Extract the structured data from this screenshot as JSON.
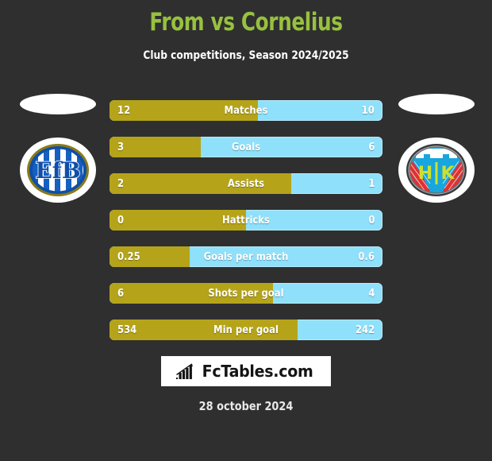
{
  "header": {
    "title": "From vs Cornelius",
    "subtitle": "Club competitions, Season 2024/2025",
    "title_color": "#97c13f",
    "background_color": "#2f2f2f"
  },
  "crests": {
    "home": {
      "name": "EfB",
      "alt": "home-club-crest"
    },
    "away": {
      "name": "HIK",
      "alt": "away-club-crest"
    }
  },
  "colors": {
    "home_bar": "#b5a41a",
    "away_bar": "#8fe0fb",
    "text": "#ffffff"
  },
  "chart_data": {
    "type": "bar",
    "title": "From vs Cornelius",
    "subtitle": "Club competitions, Season 2024/2025",
    "orientation": "horizontal-diverging",
    "categories": [
      "Matches",
      "Goals",
      "Assists",
      "Hattricks",
      "Goals per match",
      "Shots per goal",
      "Min per goal"
    ],
    "series": [
      {
        "name": "From",
        "side": "left",
        "color": "#b5a41a",
        "values": [
          12,
          3,
          2,
          0,
          0.25,
          6,
          534
        ],
        "display": [
          "12",
          "3",
          "2",
          "0",
          "0.25",
          "6",
          "534"
        ]
      },
      {
        "name": "Cornelius",
        "side": "right",
        "color": "#8fe0fb",
        "values": [
          10,
          6,
          1,
          0,
          0.6,
          4,
          242
        ],
        "display": [
          "10",
          "6",
          "1",
          "0",
          "0.6",
          "4",
          "242"
        ]
      }
    ],
    "left_share_percent": [
      54.5,
      33.3,
      66.7,
      50,
      29.4,
      60,
      68.8
    ],
    "legend": "none",
    "grid": false
  },
  "rows": [
    {
      "label": "Matches",
      "home": "12",
      "away": "10",
      "pct": 54.5
    },
    {
      "label": "Goals",
      "home": "3",
      "away": "6",
      "pct": 33.3
    },
    {
      "label": "Assists",
      "home": "2",
      "away": "1",
      "pct": 66.7
    },
    {
      "label": "Hattricks",
      "home": "0",
      "away": "0",
      "pct": 50.0
    },
    {
      "label": "Goals per match",
      "home": "0.25",
      "away": "0.6",
      "pct": 29.4
    },
    {
      "label": "Shots per goal",
      "home": "6",
      "away": "4",
      "pct": 60.0
    },
    {
      "label": "Min per goal",
      "home": "534",
      "away": "242",
      "pct": 68.8
    }
  ],
  "footer": {
    "logo_text": "FcTables.com",
    "logo_icon": "bar-chart-icon",
    "date": "28 october 2024"
  }
}
